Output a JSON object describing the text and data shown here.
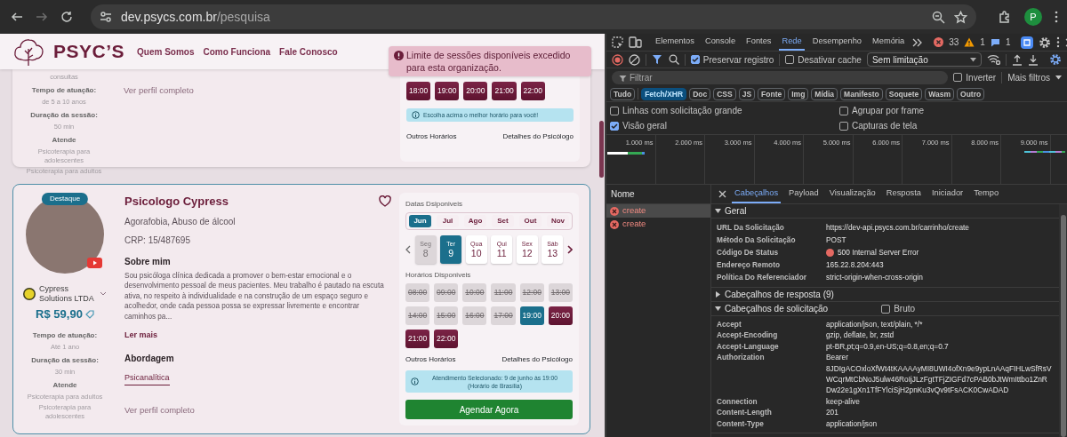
{
  "browser": {
    "url_host": "dev.psycs.com.br",
    "url_path": "/pesquisa",
    "profile_initial": "P"
  },
  "site": {
    "logo_text": "PSYC’S",
    "nav_links": [
      "Quem Somos",
      "Como Funciona",
      "Fale Conosco"
    ],
    "toast": {
      "text": "Limite de sessões disponíveis excedido para esta organização."
    },
    "cards": [
      {
        "info": [
          {
            "values": [
              "consultas"
            ]
          },
          {
            "label": "Tempo de atuação:",
            "values": [
              "de 5 a 10 anos"
            ]
          },
          {
            "label": "Duração da sessão:",
            "values": [
              "50 min"
            ]
          },
          {
            "label": "Atende",
            "values": [
              "Psicoterapia para adolescentes",
              "Psicoterapia para adultos"
            ]
          }
        ],
        "profile_link": "Ver perfil completo",
        "schedule": {
          "slots": [
            {
              "time": "18:00",
              "available": true,
              "selected": false
            },
            {
              "time": "19:00",
              "available": true,
              "selected": false
            },
            {
              "time": "20:00",
              "available": true,
              "selected": false
            },
            {
              "time": "21:00",
              "available": true,
              "selected": false
            },
            {
              "time": "22:00",
              "available": true,
              "selected": false
            }
          ],
          "notice": "Escolha acima o melhor horário para você!",
          "links": [
            "Outros Horários",
            "Detalhes do Psicólogo"
          ]
        }
      },
      {
        "featured_badge": "Destaque",
        "company": "Cypress Solutions LTDA",
        "price": "R$ 59,90",
        "info": [
          {
            "label": "Tempo de atuação:",
            "values": [
              "Até 1 ano"
            ]
          },
          {
            "label": "Duração da sessão:",
            "values": [
              "30 min"
            ]
          },
          {
            "label": "Atende",
            "values": [
              "Psicoterapia para adultos",
              "Psicoterapia para adolescentes"
            ]
          }
        ],
        "name": "Psicologo Cypress",
        "favorite": false,
        "specialties": "Agorafobia, Abuso de álcool",
        "crp": "CRP: 15/487695",
        "about_title": "Sobre mim",
        "about": "Sou psicóloga clínica dedicada a promover o bem-estar emocional e o desenvolvimento pessoal de meus pacientes. Meu trabalho é pautado na escuta ativa, no respeito à individualidade e na construção de um espaço seguro e acolhedor, onde cada pessoa possa se expressar livremente e encontrar caminhos pa...",
        "read_more": "Ler mais",
        "approach_title": "Abordagem",
        "approaches": [
          "Psicanalítica"
        ],
        "profile_link": "Ver perfil completo",
        "schedule": {
          "dates_title": "Datas Dsiponiveis",
          "months": [
            {
              "label": "Jun",
              "selected": true
            },
            {
              "label": "Jul",
              "selected": false
            },
            {
              "label": "Ago",
              "selected": false
            },
            {
              "label": "Set",
              "selected": false
            },
            {
              "label": "Out",
              "selected": false
            },
            {
              "label": "Nov",
              "selected": false
            }
          ],
          "days": [
            {
              "weekday": "Seg",
              "day": "8",
              "selected": false,
              "disabled": true
            },
            {
              "weekday": "Ter",
              "day": "9",
              "selected": true,
              "disabled": false
            },
            {
              "weekday": "Qua",
              "day": "10",
              "selected": false,
              "disabled": false
            },
            {
              "weekday": "Qui",
              "day": "11",
              "selected": false,
              "disabled": false
            },
            {
              "weekday": "Sex",
              "day": "12",
              "selected": false,
              "disabled": false
            },
            {
              "weekday": "Sáb",
              "day": "13",
              "selected": false,
              "disabled": false
            }
          ],
          "times_title": "Horários Disponiveis",
          "slots": [
            {
              "time": "08:00",
              "available": false,
              "selected": false
            },
            {
              "time": "09:00",
              "available": false,
              "selected": false
            },
            {
              "time": "10:00",
              "available": false,
              "selected": false
            },
            {
              "time": "11:00",
              "available": false,
              "selected": false
            },
            {
              "time": "12:00",
              "available": false,
              "selected": false
            },
            {
              "time": "13:00",
              "available": false,
              "selected": false
            },
            {
              "time": "14:00",
              "available": false,
              "selected": false
            },
            {
              "time": "15:00",
              "available": false,
              "selected": false
            },
            {
              "time": "16:00",
              "available": false,
              "selected": false
            },
            {
              "time": "17:00",
              "available": false,
              "selected": false
            },
            {
              "time": "19:00",
              "available": true,
              "selected": true
            },
            {
              "time": "20:00",
              "available": true,
              "selected": false
            },
            {
              "time": "21:00",
              "available": true,
              "selected": false
            },
            {
              "time": "22:00",
              "available": true,
              "selected": false
            }
          ],
          "links": [
            "Outros Horários",
            "Detalhes do Psicólogo"
          ],
          "notice": "Atendimento Selecionado: 9 de junho às 19:00 (Horário de Brasília)",
          "book_button": "Agendar Agora"
        }
      }
    ]
  },
  "devtools": {
    "tabs": [
      {
        "label": "Elementos",
        "selected": false
      },
      {
        "label": "Console",
        "selected": false
      },
      {
        "label": "Fontes",
        "selected": false
      },
      {
        "label": "Rede",
        "selected": true
      },
      {
        "label": "Desempenho",
        "selected": false
      },
      {
        "label": "Memória",
        "selected": false
      }
    ],
    "counts": {
      "errors": "33",
      "warnings": "1",
      "messages": "1"
    },
    "toolbar": {
      "preserve_log": {
        "label": "Preservar registro",
        "checked": true
      },
      "disable_cache": {
        "label": "Desativar cache",
        "checked": false
      },
      "throttling": "Sem limitação"
    },
    "filter": {
      "placeholder": "Filtrar",
      "invert": {
        "label": "Inverter",
        "checked": false
      },
      "more_filters": "Mais filtros"
    },
    "type_filters": [
      {
        "label": "Tudo",
        "selected": false
      },
      {
        "label": "Fetch/XHR",
        "selected": true
      },
      {
        "label": "Doc",
        "selected": false
      },
      {
        "label": "CSS",
        "selected": false
      },
      {
        "label": "JS",
        "selected": false
      },
      {
        "label": "Fonte",
        "selected": false
      },
      {
        "label": "Img",
        "selected": false
      },
      {
        "label": "Mídia",
        "selected": false
      },
      {
        "label": "Manifesto",
        "selected": false
      },
      {
        "label": "Soquete",
        "selected": false
      },
      {
        "label": "Wasm",
        "selected": false
      },
      {
        "label": "Outro",
        "selected": false
      }
    ],
    "options": [
      {
        "label": "Linhas com solicitação grande",
        "checked": false
      },
      {
        "label": "Agrupar por frame",
        "checked": false
      },
      {
        "label": "Visão geral",
        "checked": true
      },
      {
        "label": "Capturas de tela",
        "checked": false
      }
    ],
    "overview": {
      "ticks": [
        "1.000 ms",
        "2.000 ms",
        "3.000 ms",
        "4.000 ms",
        "5.000 ms",
        "6.000 ms",
        "7.000 ms",
        "8.000 ms",
        "9.000 ms"
      ]
    },
    "name_header": "Nome",
    "requests": [
      {
        "name": "create",
        "selected": true,
        "failed": true
      },
      {
        "name": "create",
        "selected": false,
        "failed": true
      }
    ],
    "detail_tabs": [
      {
        "label": "Cabeçalhos",
        "selected": true
      },
      {
        "label": "Payload",
        "selected": false
      },
      {
        "label": "Visualização",
        "selected": false
      },
      {
        "label": "Resposta",
        "selected": false
      },
      {
        "label": "Iniciador",
        "selected": false
      },
      {
        "label": "Tempo",
        "selected": false
      }
    ],
    "sections": [
      {
        "title": "Geral",
        "expanded": true,
        "rows": [
          {
            "name": "URL Da Solicitação",
            "value": "https://dev-api.psycs.com.br/carrinho/create",
            "error": false
          },
          {
            "name": "Método Da Solicitação",
            "value": "POST",
            "error": false
          },
          {
            "name": "Código De Status",
            "value": "500 Internal Server Error",
            "error": true
          },
          {
            "name": "Endereço Remoto",
            "value": "165.22.8.204:443",
            "error": false
          },
          {
            "name": "Política Do Referenciador",
            "value": "strict-origin-when-cross-origin",
            "error": false
          }
        ]
      },
      {
        "title": "Cabeçalhos de resposta (9)",
        "expanded": false
      },
      {
        "title": "Cabeçalhos de solicitação",
        "expanded": true,
        "raw": {
          "label": "Bruto",
          "checked": false
        },
        "rows": [
          {
            "name": "Accept",
            "value": "application/json, text/plain, */*"
          },
          {
            "name": "Accept-Encoding",
            "value": "gzip, deflate, br, zstd"
          },
          {
            "name": "Accept-Language",
            "value": "pt-BR,pt;q=0.9,en-US;q=0.8,en;q=0.7"
          },
          {
            "name": "Authorization",
            "value": "Bearer 8JDIgACOxloXfWt4tKAAAAyMI8UWI4ofXn9e9ypLnAAqFIHLwSfRsVWCqrMtCbNoJ5ulw46RoIjJLzFgtTFjZIGFd7cPAB0bJtWmIttbo1ZnRDw22e1gXn1TfFYlciSjH2pnKu3vQv9tFsACK0CwADAD"
          },
          {
            "name": "Connection",
            "value": "keep-alive"
          },
          {
            "name": "Content-Length",
            "value": "201"
          },
          {
            "name": "Content-Type",
            "value": "application/json"
          }
        ]
      }
    ]
  }
}
